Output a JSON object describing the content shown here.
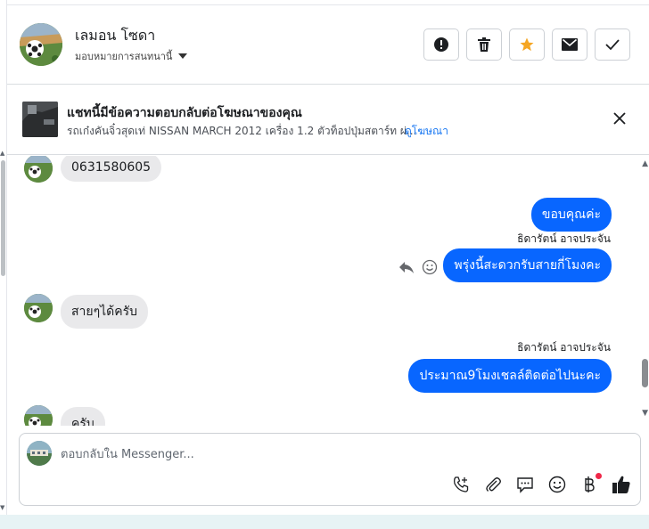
{
  "header": {
    "contact_name": "เลมอน โซดา",
    "assign_label": "มอบหมายการสนทนานี้",
    "actions": [
      {
        "name": "report-button",
        "icon": "alert-icon"
      },
      {
        "name": "delete-button",
        "icon": "trash-icon"
      },
      {
        "name": "star-button",
        "icon": "star-icon",
        "color": "#f5a623"
      },
      {
        "name": "mark-unread-button",
        "icon": "envelope-icon"
      },
      {
        "name": "mark-done-button",
        "icon": "check-icon"
      }
    ]
  },
  "ad": {
    "title": "แชทนี้มีข้อความตอบกลับต่อโฆษณาของคุณ",
    "subtitle": "รถเก๋งคันจิ๋วสุดเท่ NISSAN MARCH 2012 เครื่อง 1.2 ตัวท็อปปุ่มสตาร์ท ผ่...",
    "link": "ดูโฆษณา"
  },
  "messages": [
    {
      "dir": "in",
      "text": "0631580605"
    },
    {
      "dir": "out",
      "text": "ขอบคุณค่ะ"
    },
    {
      "dir": "out",
      "sender": "ธิดารัตน์ อาจประจัน",
      "text": "พรุ่งนี้สะดวกรับสายกี่โมงคะ"
    },
    {
      "dir": "in",
      "text": "สายๆได้ครับ"
    },
    {
      "dir": "out",
      "sender": "ธิดารัตน์ อาจประจัน",
      "text": "ประมาณ9โมงเชลล์ติดต่อไปนะคะ"
    },
    {
      "dir": "in",
      "text": "ครับ"
    }
  ],
  "composer": {
    "placeholder": "ตอบกลับใน Messenger..."
  },
  "colors": {
    "accent": "#0866ff",
    "link": "#1877f2",
    "incoming_bubble": "#e9e9eb",
    "notification_dot": "#f02849"
  }
}
